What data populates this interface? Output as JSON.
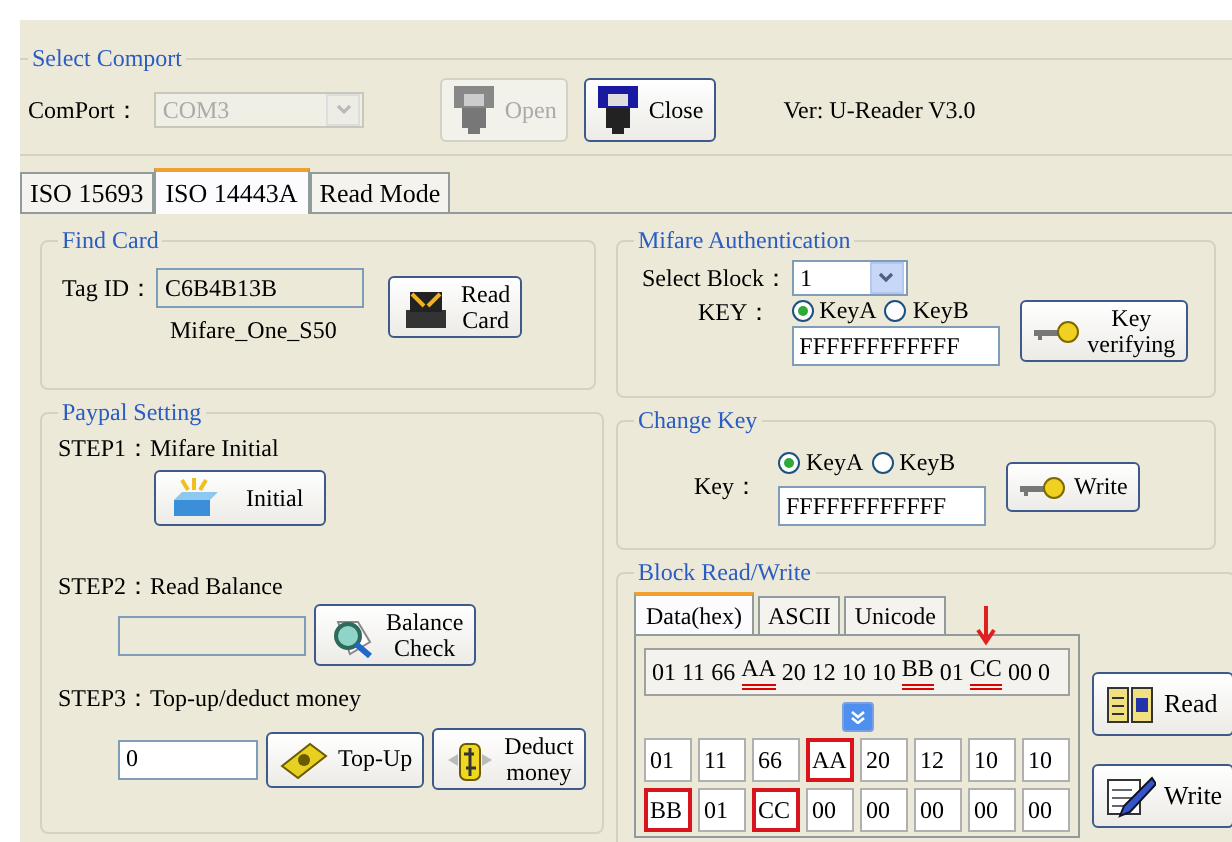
{
  "comport_group": {
    "title": "Select Comport",
    "label": "ComPort：",
    "port": "COM3",
    "port_disabled": true,
    "buttons": [
      {
        "label": "Open",
        "disabled": true
      },
      {
        "label": "Close",
        "disabled": false
      }
    ],
    "version": "Ver: U-Reader V3.0"
  },
  "tabs": [
    {
      "label": "ISO 15693",
      "selected": false
    },
    {
      "label": "ISO 14443A",
      "selected": true
    },
    {
      "label": "Read Mode",
      "selected": false
    }
  ],
  "find_card": {
    "title": "Find Card",
    "tag_label": "Tag ID：",
    "tag_value": "C6B4B13B",
    "card_type": "Mifare_One_S50",
    "button": [
      "Read",
      "Card"
    ]
  },
  "paypal": {
    "title": "Paypal Setting",
    "step1": "STEP1：Mifare Initial",
    "initial_button": "Initial",
    "step2": "STEP2：Read Balance",
    "balance_button": [
      "Balance",
      "Check"
    ],
    "step3": "STEP3：Top-up/deduct money",
    "amount": "0",
    "topup_button": "Top-Up",
    "deduct_button": [
      "Deduct",
      "money"
    ]
  },
  "auth": {
    "title": "Mifare Authentication",
    "block_label": "Select Block：",
    "block": "1",
    "key_label": "KEY：",
    "key_options": [
      {
        "label": "KeyA",
        "selected": true
      },
      {
        "label": "KeyB",
        "selected": false
      }
    ],
    "key": "FFFFFFFFFFFF",
    "button": [
      "Key",
      "verifying"
    ]
  },
  "change_key": {
    "title": "Change Key",
    "key_label": "Key：",
    "key_options": [
      {
        "label": "KeyA",
        "selected": true
      },
      {
        "label": "KeyB",
        "selected": false
      }
    ],
    "key": "FFFFFFFFFFFF",
    "button": "Write"
  },
  "block_rw": {
    "title": "Block Read/Write",
    "tabs": [
      {
        "label": "Data(hex)",
        "selected": true
      },
      {
        "label": "ASCII",
        "selected": false
      },
      {
        "label": "Unicode",
        "selected": false
      }
    ],
    "hex_tokens": [
      {
        "text": "01",
        "marked": false,
        "arrow": false
      },
      {
        "text": "11",
        "marked": false,
        "arrow": false
      },
      {
        "text": "66",
        "marked": false,
        "arrow": false
      },
      {
        "text": "AA",
        "marked": true,
        "arrow": false
      },
      {
        "text": "20",
        "marked": false,
        "arrow": false
      },
      {
        "text": "12",
        "marked": false,
        "arrow": false
      },
      {
        "text": "10",
        "marked": false,
        "arrow": false
      },
      {
        "text": "10",
        "marked": false,
        "arrow": false
      },
      {
        "text": "BB",
        "marked": true,
        "arrow": false
      },
      {
        "text": "01",
        "marked": false,
        "arrow": false
      },
      {
        "text": "CC",
        "marked": true,
        "arrow": true
      },
      {
        "text": "00",
        "marked": false,
        "arrow": false
      },
      {
        "text": "0",
        "marked": false,
        "arrow": false
      }
    ],
    "cells": [
      {
        "text": "01",
        "marked": false
      },
      {
        "text": "11",
        "marked": false
      },
      {
        "text": "66",
        "marked": false
      },
      {
        "text": "AA",
        "marked": true
      },
      {
        "text": "20",
        "marked": false
      },
      {
        "text": "12",
        "marked": false
      },
      {
        "text": "10",
        "marked": false
      },
      {
        "text": "10",
        "marked": false
      },
      {
        "text": "BB",
        "marked": true
      },
      {
        "text": "01",
        "marked": false
      },
      {
        "text": "CC",
        "marked": true
      },
      {
        "text": "00",
        "marked": false
      },
      {
        "text": "00",
        "marked": false
      },
      {
        "text": "00",
        "marked": false
      },
      {
        "text": "00",
        "marked": false
      },
      {
        "text": "00",
        "marked": false
      }
    ],
    "read_button": "Read",
    "write_button": "Write"
  }
}
